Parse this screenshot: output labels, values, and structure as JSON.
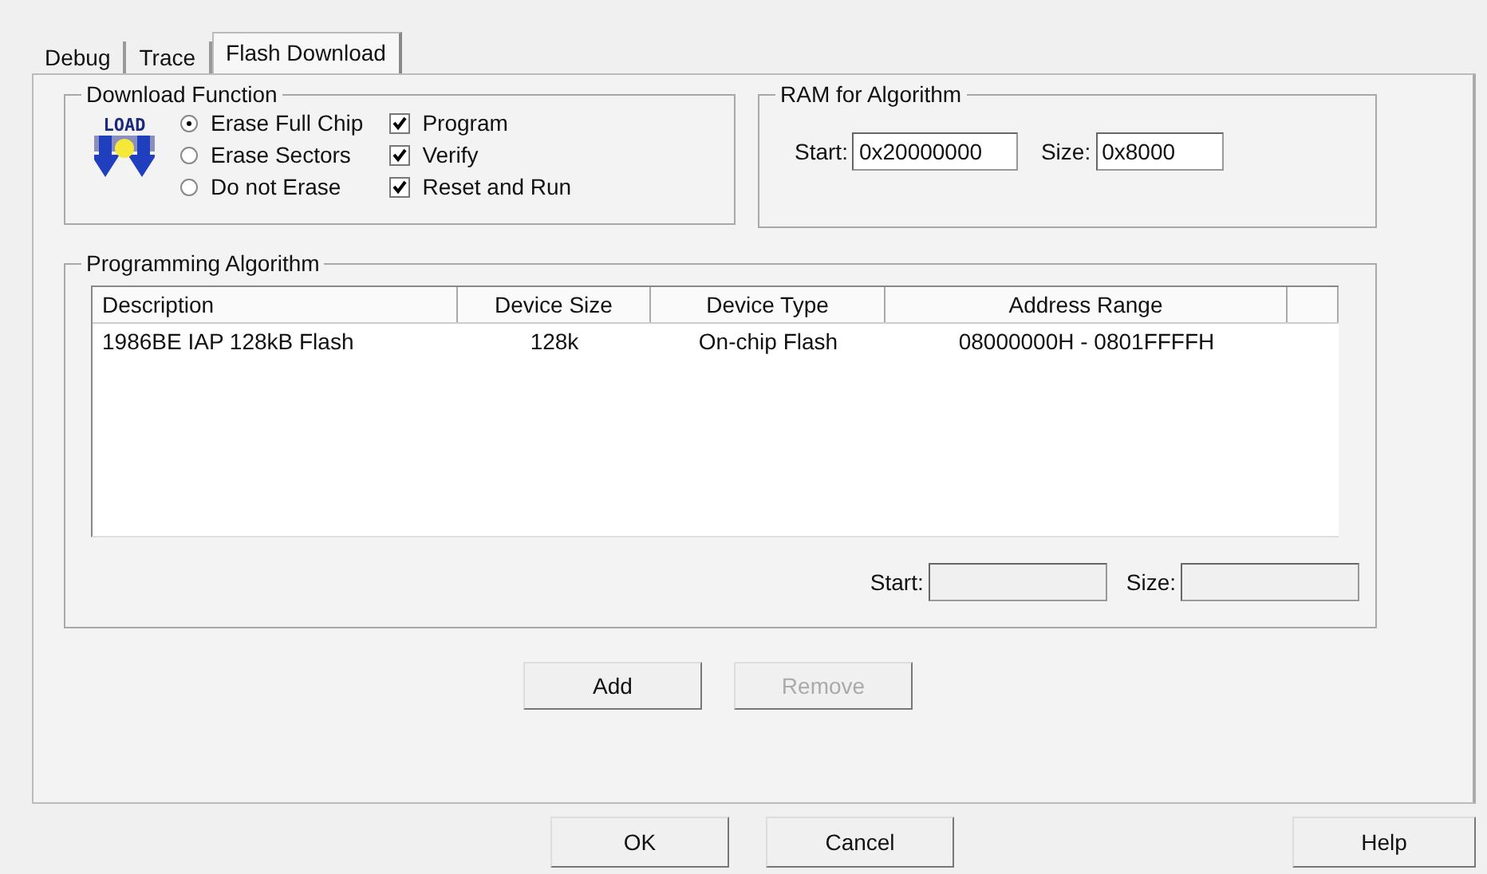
{
  "tabs": [
    {
      "label": "Debug",
      "selected": false
    },
    {
      "label": "Trace",
      "selected": false
    },
    {
      "label": "Flash Download",
      "selected": true
    }
  ],
  "download_function": {
    "title": "Download Function",
    "icon_text": "LOAD",
    "radios": [
      {
        "label": "Erase Full Chip",
        "selected": true
      },
      {
        "label": "Erase Sectors",
        "selected": false
      },
      {
        "label": "Do not Erase",
        "selected": false
      }
    ],
    "checkboxes": [
      {
        "label": "Program",
        "checked": true
      },
      {
        "label": "Verify",
        "checked": true
      },
      {
        "label": "Reset and Run",
        "checked": true
      }
    ]
  },
  "ram_for_algorithm": {
    "title": "RAM for Algorithm",
    "fields": [
      {
        "label": "Start:",
        "value": "0x20000000",
        "disabled": false
      },
      {
        "label": "Size:",
        "value": "0x8000",
        "disabled": false
      }
    ]
  },
  "programming_algorithm": {
    "title": "Programming Algorithm",
    "columns": [
      "Description",
      "Device Size",
      "Device Type",
      "Address Range"
    ],
    "rows": [
      [
        "1986BE IAP 128kB Flash",
        "128k",
        "On-chip Flash",
        "08000000H - 0801FFFFH"
      ]
    ],
    "fields": [
      {
        "label": "Start:",
        "disabled": true
      },
      {
        "label": "Size:",
        "disabled": true
      }
    ]
  },
  "buttons": [
    {
      "label": "Add",
      "disabled": false
    },
    {
      "label": "Remove",
      "disabled": true
    }
  ],
  "dialog_buttons": [
    {
      "label": "OK"
    },
    {
      "label": "Cancel"
    },
    {
      "label": "Help"
    }
  ]
}
